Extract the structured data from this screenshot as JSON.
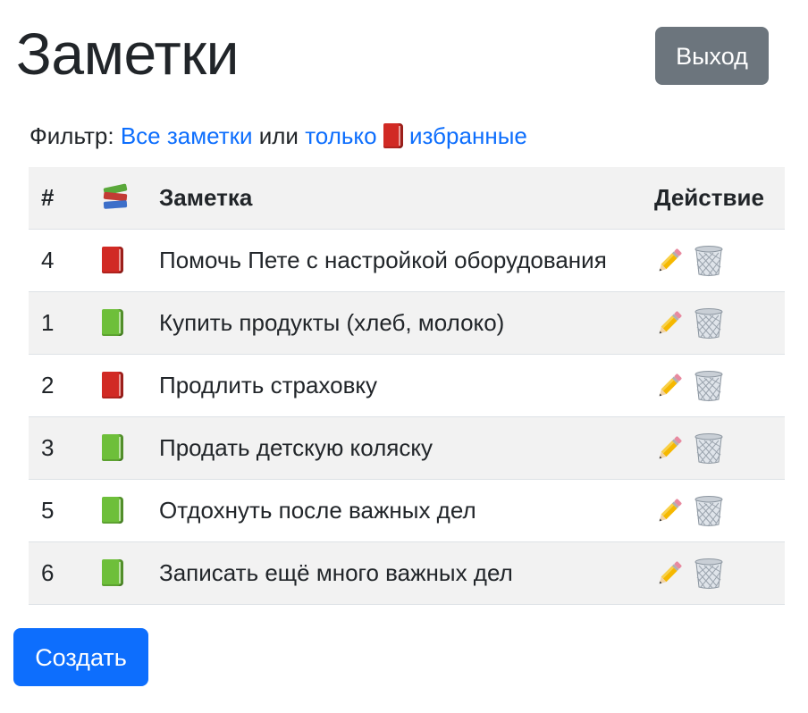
{
  "header": {
    "title": "Заметки",
    "logout_label": "Выход"
  },
  "filter": {
    "prefix": "Фильтр:",
    "all_link": "Все заметки",
    "or_text": "или",
    "only_link": "только",
    "favorites_icon": "red-book-icon",
    "favorites_link": "избранные"
  },
  "table": {
    "headers": {
      "number": "#",
      "icon": "books-icon",
      "note": "Заметка",
      "action": "Действие"
    },
    "rows": [
      {
        "id": "4",
        "favorite": true,
        "text": "Помочь Пете с настройкой оборудования"
      },
      {
        "id": "1",
        "favorite": false,
        "text": "Купить продукты (хлеб, молоко)"
      },
      {
        "id": "2",
        "favorite": true,
        "text": "Продлить страховку"
      },
      {
        "id": "3",
        "favorite": false,
        "text": "Продать детскую коляску"
      },
      {
        "id": "5",
        "favorite": false,
        "text": "Отдохнуть после важных дел"
      },
      {
        "id": "6",
        "favorite": false,
        "text": "Записать ещё много важных дел"
      }
    ],
    "action_icons": [
      "pencil-icon",
      "wastebasket-icon"
    ]
  },
  "footer": {
    "create_label": "Создать"
  },
  "colors": {
    "primary": "#0d6efd",
    "secondary": "#6c757d",
    "favorite_book": "#d12a24",
    "regular_book": "#6ebf3a",
    "striped_row": "#f2f2f2"
  }
}
